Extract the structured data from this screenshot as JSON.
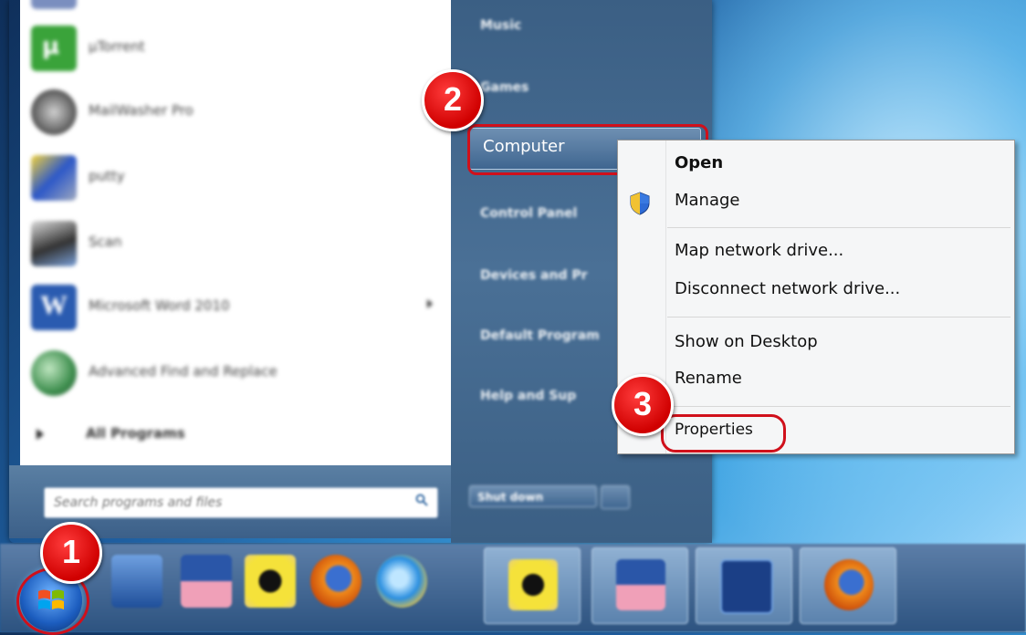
{
  "start_menu": {
    "programs": [
      {
        "name": "µTorrent",
        "icon": "utorrent-icon"
      },
      {
        "name": "MailWasher Pro",
        "icon": "mailwasher-icon"
      },
      {
        "name": "putty",
        "icon": "putty-icon"
      },
      {
        "name": "Scan",
        "icon": "scan-icon"
      },
      {
        "name": "Microsoft Word 2010",
        "icon": "word-icon",
        "has_submenu": true
      },
      {
        "name": "Advanced Find and Replace",
        "icon": "magnifier-icon"
      }
    ],
    "all_programs": "All Programs",
    "search_placeholder": "Search programs and files",
    "right_items": [
      "Music",
      "Games",
      "Computer",
      "Control Panel",
      "Devices and Pr",
      "Default Program",
      "Help and Sup"
    ],
    "shutdown_label": "Shut down"
  },
  "context_menu": {
    "items": [
      {
        "label": "Open",
        "bold": true
      },
      {
        "label": "Manage",
        "icon": "uac-shield-icon"
      },
      {
        "label": "Map network drive..."
      },
      {
        "label": "Disconnect network drive..."
      },
      {
        "label": "Show on Desktop"
      },
      {
        "label": "Rename"
      },
      {
        "label": "Properties"
      }
    ]
  },
  "callouts": [
    "1",
    "2",
    "3"
  ],
  "colors": {
    "callout_red": "#d0101b",
    "menu_blue": "#3b5f84"
  }
}
